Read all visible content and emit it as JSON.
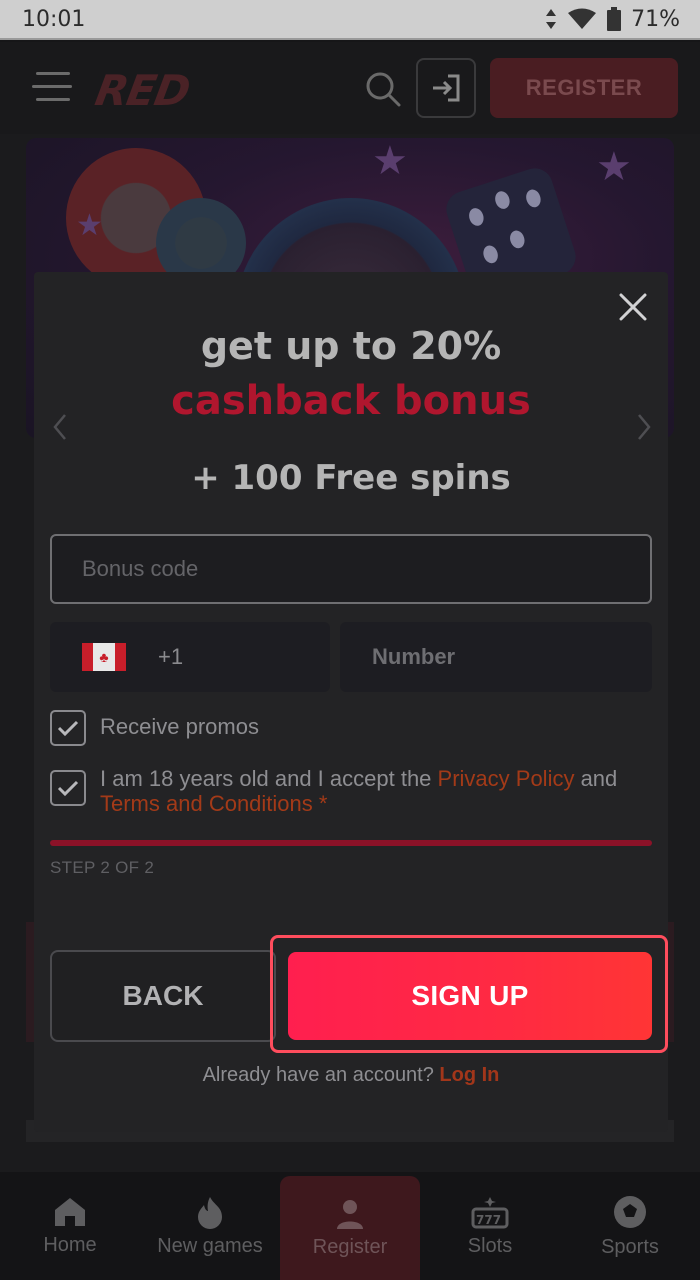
{
  "status_bar": {
    "time": "10:01",
    "battery": "71%"
  },
  "header": {
    "logo": "RED",
    "register_label": "REGISTER"
  },
  "modal": {
    "promo_line1": "get up to 20%",
    "promo_line2": "cashback bonus",
    "promo_line3": "+ 100 Free spins",
    "bonus_code_placeholder": "Bonus code",
    "dial_code": "+1",
    "number_placeholder": "Number",
    "receive_promos_label": "Receive promos",
    "age_text_prefix": "I am 18 years old and I accept the ",
    "privacy_policy_link": "Privacy Policy",
    "age_text_and": " and",
    "terms_link": "Terms and Conditions",
    "required_mark": " *",
    "step_label": "STEP 2 OF 2",
    "back_label": "BACK",
    "signup_label": "SIGN UP",
    "already_text": "Already have an account? ",
    "login_link": "Log In"
  },
  "bottom_nav": {
    "items": [
      {
        "label": "Home",
        "icon": "home-icon"
      },
      {
        "label": "New games",
        "icon": "fire-icon"
      },
      {
        "label": "Register",
        "icon": "user-icon"
      },
      {
        "label": "Slots",
        "icon": "slot-machine-icon"
      },
      {
        "label": "Sports",
        "icon": "soccer-ball-icon"
      }
    ]
  },
  "colors": {
    "accent": "#ff2a45",
    "promo_red": "#b0162e",
    "link_orange": "#a33a18"
  }
}
